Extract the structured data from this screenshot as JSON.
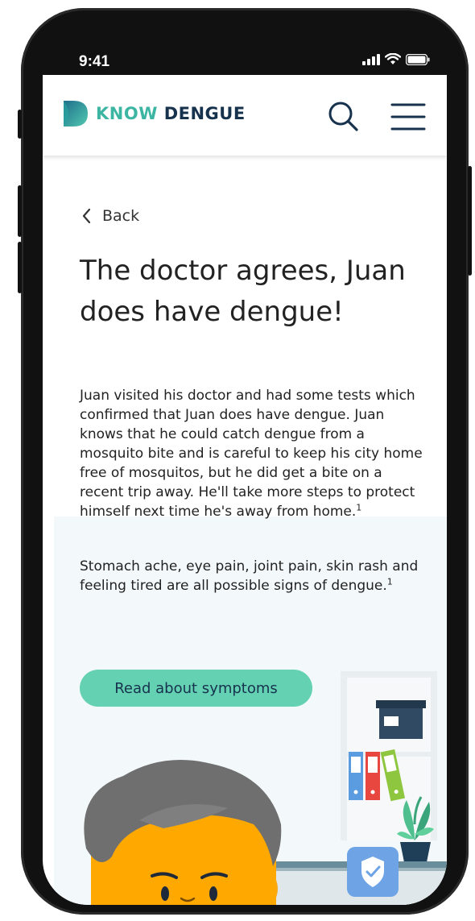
{
  "status_bar": {
    "time": "9:41",
    "icons": [
      "signal-icon",
      "wifi-icon",
      "battery-icon"
    ]
  },
  "header": {
    "logo_word_1": "KNOW",
    "logo_word_2": "DENGUE",
    "search_icon": "search-icon",
    "menu_icon": "hamburger-menu-icon"
  },
  "nav": {
    "back_label": "Back"
  },
  "article": {
    "title": "The doctor agrees, Juan does have dengue!",
    "paragraph_1": "Juan visited his doctor and had some tests which confirmed that Juan does have dengue. Juan knows that he could catch dengue from a mosquito bite and is careful to keep his city home free of mosquitos, but he did get a bite on a recent trip away. He'll take more steps to protect himself next time he's away from home.",
    "paragraph_1_ref": "1",
    "paragraph_2": "Stomach ache, eye pain, joint pain, skin rash and feeling tired are all possible signs of dengue.",
    "paragraph_2_ref": "1",
    "cta_label": "Read about symptoms"
  },
  "colors": {
    "brand_teal": "#3cb6a3",
    "brand_navy": "#17324d",
    "cta_green": "#64d1b3",
    "badge_blue": "#6ea3e6",
    "background_tint": "#f3f9fb"
  },
  "privacy_badge_icon": "shield-check-icon"
}
